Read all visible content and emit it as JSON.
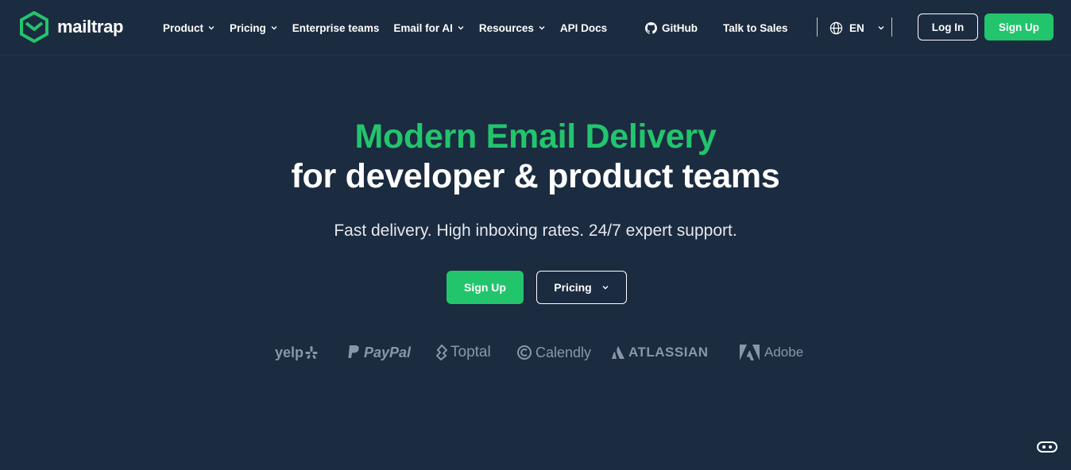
{
  "header": {
    "logo_text": "mailtrap",
    "nav": [
      {
        "label": "Product",
        "has_dropdown": true
      },
      {
        "label": "Pricing",
        "has_dropdown": true
      },
      {
        "label": "Enterprise teams",
        "has_dropdown": false
      },
      {
        "label": "Email for AI",
        "has_dropdown": true
      },
      {
        "label": "Resources",
        "has_dropdown": true
      },
      {
        "label": "API Docs",
        "has_dropdown": false
      }
    ],
    "github_label": "GitHub",
    "sales_label": "Talk to Sales",
    "language": "EN",
    "login_label": "Log In",
    "signup_label": "Sign Up"
  },
  "hero": {
    "title_line1": "Modern Email Delivery",
    "title_line2": "for developer & product teams",
    "subtitle": "Fast delivery. High inboxing rates. 24/7 expert support.",
    "signup_label": "Sign Up",
    "pricing_label": "Pricing"
  },
  "logos": [
    "yelp",
    "PayPal",
    "Toptal",
    "Calendly",
    "ATLASSIAN",
    "Adobe"
  ],
  "icons": {
    "logo": "mailtrap-logo-icon",
    "github": "github-icon",
    "globe": "globe-icon",
    "chevron": "chevron-down-icon",
    "chat": "chat-widget-icon"
  },
  "colors": {
    "background": "#1b2b40",
    "accent": "#22c56c",
    "text": "#ffffff",
    "logo_gray": "#8a97a8"
  }
}
